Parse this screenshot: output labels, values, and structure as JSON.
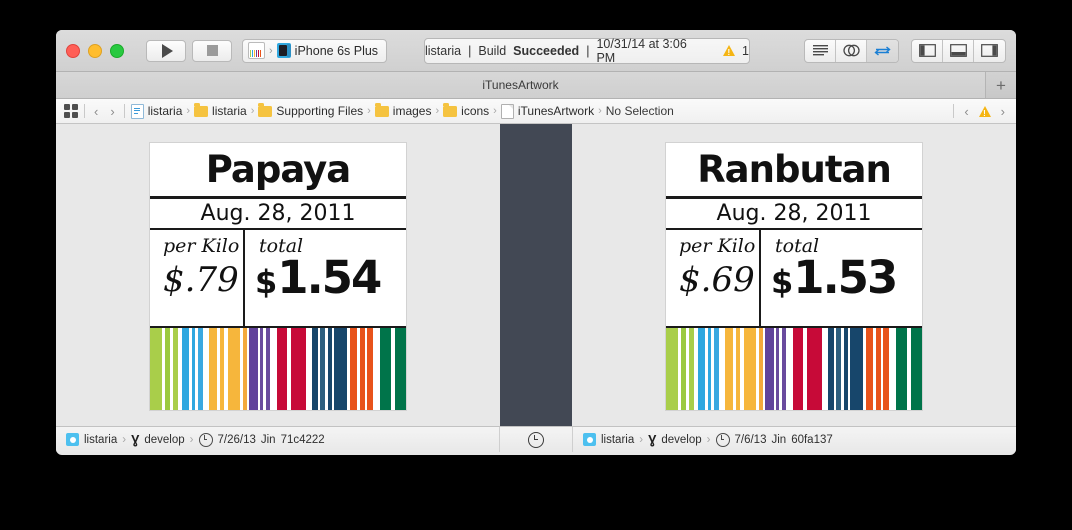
{
  "window": {
    "title": "iTunesArtwork",
    "traffic_lights": [
      "close",
      "minimize",
      "zoom"
    ]
  },
  "toolbar": {
    "run_label": "Run",
    "stop_label": "Stop",
    "scheme": {
      "project": "listaria",
      "destination": "iPhone 6s Plus",
      "separator": "›"
    },
    "status": {
      "project": "listaria",
      "divider": "|",
      "build_prefix": "Build",
      "build_result": "Succeeded",
      "timestamp": "10/31/14 at 3:06 PM",
      "warning_count": "1"
    },
    "editor_modes": [
      {
        "name": "standard-editor",
        "active": false
      },
      {
        "name": "assistant-editor",
        "active": false
      },
      {
        "name": "version-editor",
        "active": true
      }
    ],
    "view_toggles": [
      {
        "name": "navigator",
        "active": false
      },
      {
        "name": "debug-area",
        "active": false
      },
      {
        "name": "utilities",
        "active": false
      }
    ]
  },
  "tabbar": {
    "active_tab": "iTunesArtwork",
    "add_tab_label": "+"
  },
  "jumpbar": {
    "back": "‹",
    "forward": "›",
    "breadcrumbs": [
      {
        "label": "listaria",
        "icon": "project-icon"
      },
      {
        "label": "listaria",
        "icon": "folder-icon"
      },
      {
        "label": "Supporting Files",
        "icon": "folder-icon"
      },
      {
        "label": "images",
        "icon": "folder-icon"
      },
      {
        "label": "icons",
        "icon": "folder-icon"
      },
      {
        "label": "iTunesArtwork",
        "icon": "file-icon"
      },
      {
        "label": "No Selection",
        "icon": "none"
      }
    ],
    "separator": "›",
    "issue_prev": "‹",
    "issue_next": "›"
  },
  "editor": {
    "left": {
      "artwork": {
        "name": "Papaya",
        "date": "Aug. 28, 2011",
        "per_kilo_label": "per Kilo",
        "per_kilo_value": "$.79",
        "total_label": "total",
        "total_currency": "$",
        "total_value": "1.54"
      },
      "version": {
        "repo": "listaria",
        "branch": "develop",
        "date": "7/26/13",
        "author": "Jin",
        "commit": "71c4222"
      }
    },
    "right": {
      "artwork": {
        "name": "Ranbutan",
        "date": "Aug. 28, 2011",
        "per_kilo_label": "per Kilo",
        "per_kilo_value": "$.69",
        "total_label": "total",
        "total_currency": "$",
        "total_value": "1.53"
      },
      "version": {
        "repo": "listaria",
        "branch": "develop",
        "date": "7/6/13",
        "author": "Jin",
        "commit": "60fa137"
      }
    },
    "divider_color": "#424854"
  },
  "stripes": [
    {
      "c": "#a9ce4a",
      "w": 14
    },
    {
      "c": "#ffffff",
      "w": 3
    },
    {
      "c": "#9bc93f",
      "w": 5
    },
    {
      "c": "#ffffff",
      "w": 4
    },
    {
      "c": "#a9ce4a",
      "w": 5
    },
    {
      "c": "#ffffff",
      "w": 5
    },
    {
      "c": "#2ea7e0",
      "w": 8
    },
    {
      "c": "#ffffff",
      "w": 3
    },
    {
      "c": "#2ea7e0",
      "w": 4
    },
    {
      "c": "#ffffff",
      "w": 3
    },
    {
      "c": "#3aa8e0",
      "w": 5
    },
    {
      "c": "#ffffff",
      "w": 7
    },
    {
      "c": "#f6b63c",
      "w": 9
    },
    {
      "c": "#ffffff",
      "w": 4
    },
    {
      "c": "#f6b63c",
      "w": 4
    },
    {
      "c": "#ffffff",
      "w": 4
    },
    {
      "c": "#f6b63c",
      "w": 14
    },
    {
      "c": "#ffffff",
      "w": 3
    },
    {
      "c": "#f4a93c",
      "w": 5
    },
    {
      "c": "#ffffff",
      "w": 2
    },
    {
      "c": "#61439b",
      "w": 10
    },
    {
      "c": "#ffffff",
      "w": 2
    },
    {
      "c": "#6a4b9e",
      "w": 4
    },
    {
      "c": "#ffffff",
      "w": 3
    },
    {
      "c": "#6a4b9e",
      "w": 5
    },
    {
      "c": "#ffffff",
      "w": 7
    },
    {
      "c": "#c70a38",
      "w": 12
    },
    {
      "c": "#ffffff",
      "w": 4
    },
    {
      "c": "#c70a38",
      "w": 17
    },
    {
      "c": "#ffffff",
      "w": 7
    },
    {
      "c": "#17466b",
      "w": 6
    },
    {
      "c": "#ffffff",
      "w": 3
    },
    {
      "c": "#2d5f7f",
      "w": 5
    },
    {
      "c": "#ffffff",
      "w": 4
    },
    {
      "c": "#17466b",
      "w": 4
    },
    {
      "c": "#ffffff",
      "w": 3
    },
    {
      "c": "#17466b",
      "w": 14
    },
    {
      "c": "#ffffff",
      "w": 4
    },
    {
      "c": "#e8531b",
      "w": 7
    },
    {
      "c": "#ffffff",
      "w": 4
    },
    {
      "c": "#e8531b",
      "w": 5
    },
    {
      "c": "#ffffff",
      "w": 3
    },
    {
      "c": "#e8531b",
      "w": 6
    },
    {
      "c": "#ffffff",
      "w": 8
    },
    {
      "c": "#00744a",
      "w": 12
    },
    {
      "c": "#ffffff",
      "w": 5
    },
    {
      "c": "#00744a",
      "w": 12
    }
  ]
}
